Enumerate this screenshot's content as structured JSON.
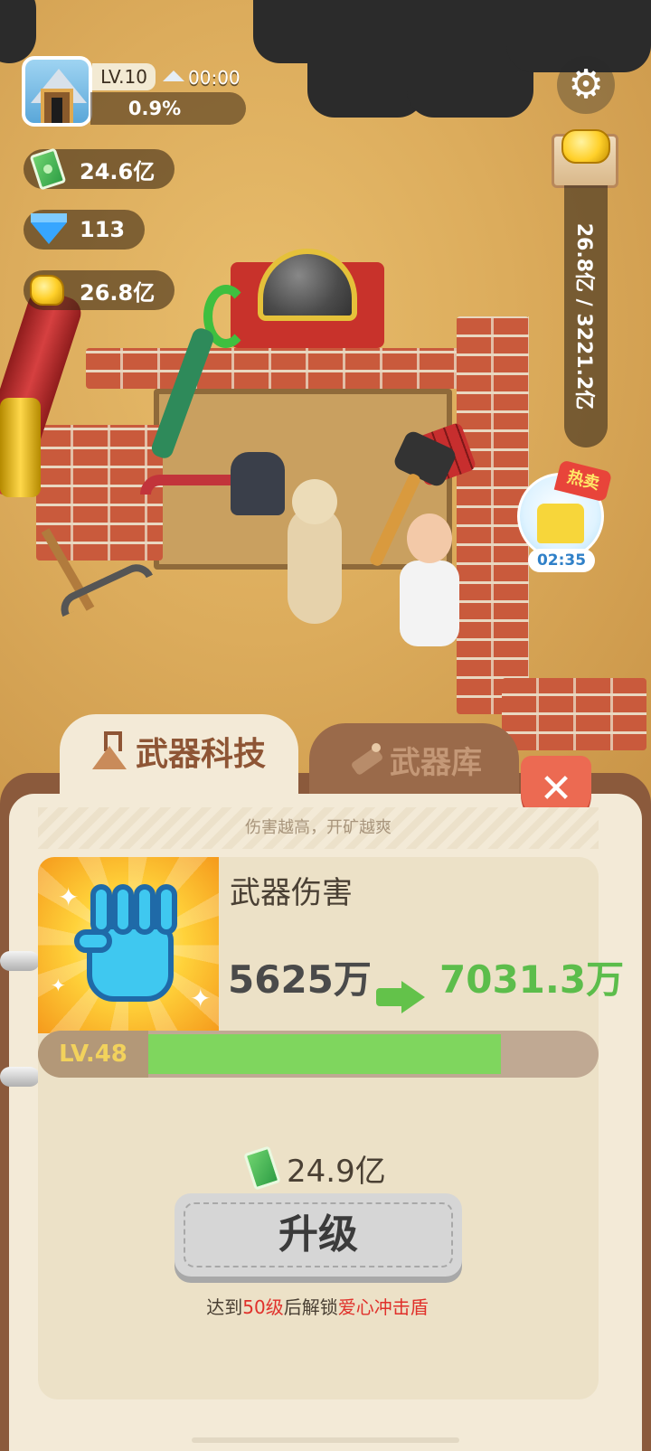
{
  "hud": {
    "level": "LV.10",
    "timer": "00:00",
    "progress": "0.9%",
    "cash": "24.6亿",
    "diamonds": "113",
    "gold": "26.8亿",
    "vault_capacity": "26.8亿 / 3221.2亿"
  },
  "promo": {
    "tag": "热卖",
    "countdown": "02:35"
  },
  "tabs": {
    "weapon_tech": "武器科技",
    "armory": "武器库"
  },
  "panel": {
    "subtitle": "伤害越高，开矿越爽",
    "stat_name": "武器伤害",
    "current_value": "5625万",
    "next_value": "7031.3万",
    "level": "LV.48",
    "level_progress": 0.79,
    "cost": "24.9亿",
    "upgrade_label": "升级",
    "unlock_prefix": "达到",
    "unlock_level": "50级",
    "unlock_middle": "后解锁",
    "unlock_item": "爱心冲击盾"
  },
  "colors": {
    "accent_green": "#5cbd4b",
    "close_red": "#ec6a52",
    "panel_bg": "#f3ead7",
    "highlight_red": "#e0312b"
  },
  "icons": [
    "mine-avatar-icon",
    "mountain-icon",
    "cash-icon",
    "diamond-icon",
    "gold-icon",
    "gear-icon",
    "gold-vault-icon",
    "shirt-icon",
    "flask-icon",
    "dynamite-icon",
    "close-icon",
    "fist-icon",
    "arrow-right-icon"
  ]
}
